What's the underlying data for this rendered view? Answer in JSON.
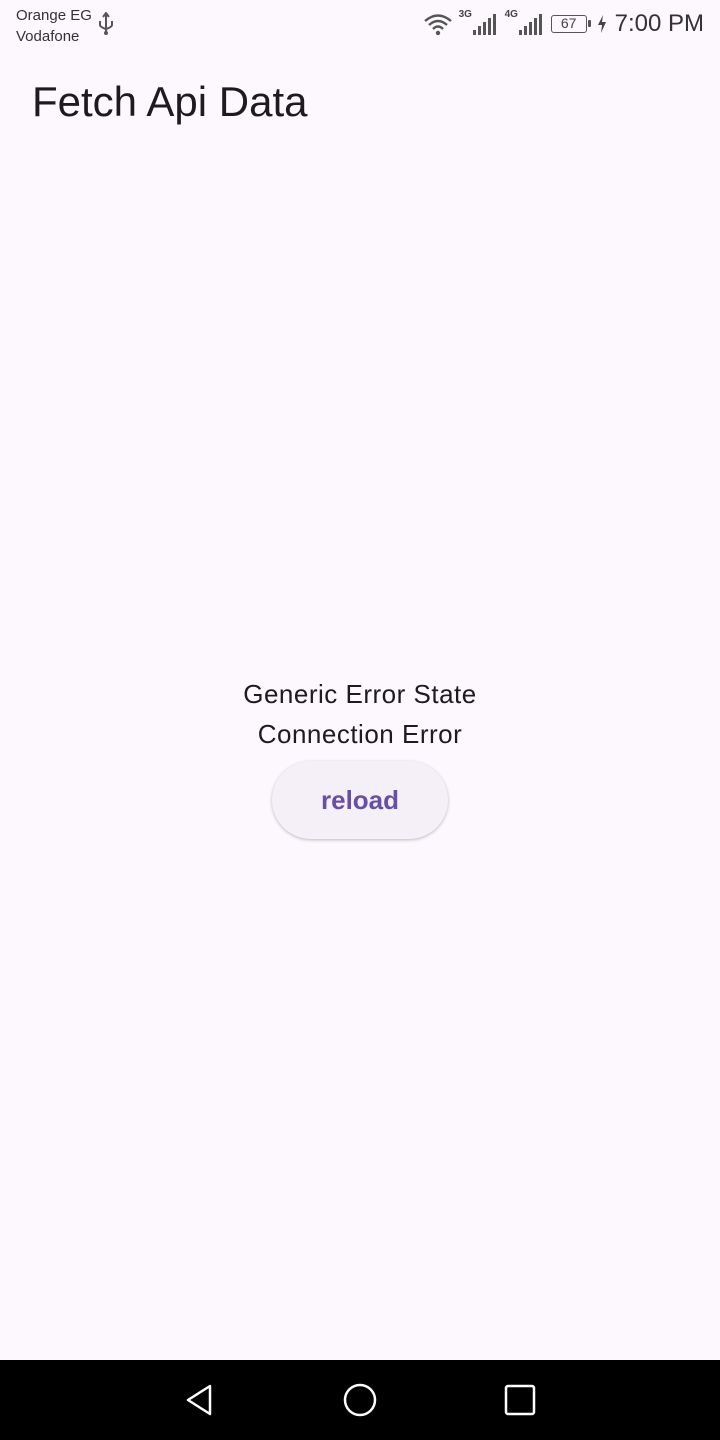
{
  "status_bar": {
    "carrier_1": "Orange EG",
    "carrier_2": "Vodafone",
    "network_1": "3G",
    "network_2": "4G",
    "battery_level": "67",
    "time": "7:00 PM",
    "icons": [
      "usb-icon",
      "wifi-icon",
      "signal-icon",
      "signal-icon",
      "battery-icon",
      "charging-icon"
    ]
  },
  "app_bar": {
    "title": "Fetch Api Data"
  },
  "error_state": {
    "title": "Generic Error State",
    "message": "Connection Error",
    "reload_label": "reload"
  },
  "nav_bar": {
    "icons": [
      "back-icon",
      "home-icon",
      "recents-icon"
    ]
  },
  "colors": {
    "background": "#fdf7fe",
    "accent": "#6750a4",
    "button_bg": "#f5eff8",
    "nav_bar": "#000000"
  }
}
